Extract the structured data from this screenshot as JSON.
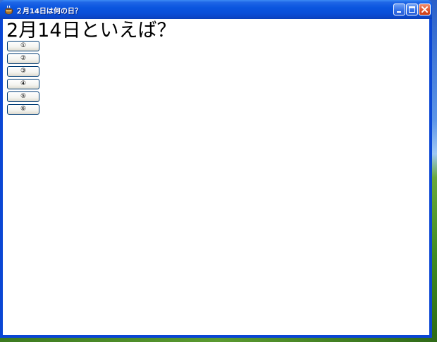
{
  "window": {
    "title": "２月14日は何の日？",
    "icon": "coffee-cup-icon",
    "controls": {
      "minimize": "minimize-icon",
      "maximize": "maximize-icon",
      "close": "close-icon"
    }
  },
  "main": {
    "heading": "2月14日といえば？",
    "options": [
      {
        "label": "①"
      },
      {
        "label": "②"
      },
      {
        "label": "③"
      },
      {
        "label": "④"
      },
      {
        "label": "⑤"
      },
      {
        "label": "⑥"
      }
    ]
  },
  "colors": {
    "titlebar": "#0a55df",
    "close_button": "#e2552d",
    "client_background": "#ffffff"
  }
}
